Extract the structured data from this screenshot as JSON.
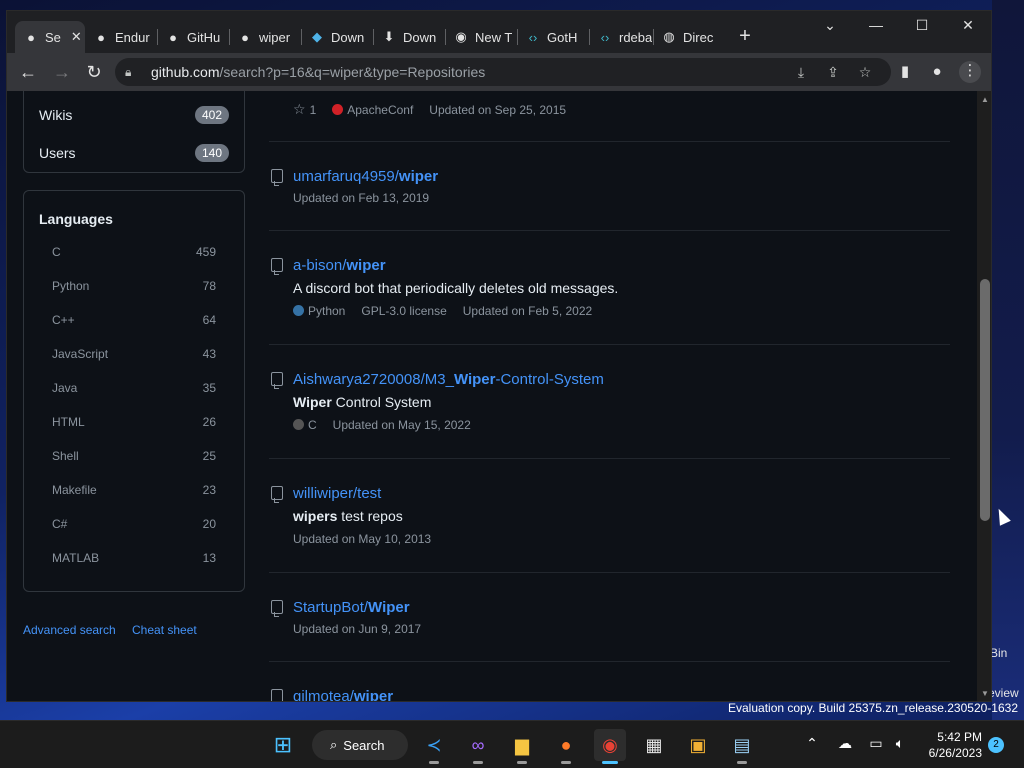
{
  "browser": {
    "tabs": [
      {
        "label": "Se",
        "icon": "github-icon",
        "active": true
      },
      {
        "label": "Endur",
        "icon": "github-icon"
      },
      {
        "label": "GitHu",
        "icon": "github-icon"
      },
      {
        "label": "wiper",
        "icon": "github-icon"
      },
      {
        "label": "Down",
        "icon": "download-chevron-icon"
      },
      {
        "label": "Down",
        "icon": "download-icon"
      },
      {
        "label": "New T",
        "icon": "chrome-icon"
      },
      {
        "label": "GotH",
        "icon": "code-icon"
      },
      {
        "label": "rdeba",
        "icon": "code-icon"
      },
      {
        "label": "Direc",
        "icon": "globe-icon"
      }
    ],
    "url_host": "github.com",
    "url_rest": "/search?p=16&q=wiper&type=Repositories"
  },
  "sidebar": {
    "type_filters": [
      {
        "label": "Wikis",
        "count": "402"
      },
      {
        "label": "Users",
        "count": "140"
      }
    ],
    "languages_title": "Languages",
    "languages": [
      {
        "name": "C",
        "count": "459"
      },
      {
        "name": "Python",
        "count": "78"
      },
      {
        "name": "C++",
        "count": "64"
      },
      {
        "name": "JavaScript",
        "count": "43"
      },
      {
        "name": "Java",
        "count": "35"
      },
      {
        "name": "HTML",
        "count": "26"
      },
      {
        "name": "Shell",
        "count": "25"
      },
      {
        "name": "Makefile",
        "count": "23"
      },
      {
        "name": "C#",
        "count": "20"
      },
      {
        "name": "MATLAB",
        "count": "13"
      }
    ],
    "advanced_search": "Advanced search",
    "cheat_sheet": "Cheat sheet"
  },
  "results": {
    "partial_top": {
      "stars": "1",
      "language": "ApacheConf",
      "language_color": "#d12127",
      "updated": "Updated on Sep 25, 2015"
    },
    "items": [
      {
        "owner": "umarfaruq4959/",
        "match": "wiper",
        "suffix": "",
        "desc_bold": "",
        "desc": "",
        "language": "",
        "license": "",
        "updated": "Updated on Feb 13, 2019"
      },
      {
        "owner": "a-bison/",
        "match": "wiper",
        "suffix": "",
        "desc_bold": "",
        "desc": "A discord bot that periodically deletes old messages.",
        "language": "Python",
        "language_color": "#3572a5",
        "license": "GPL-3.0 license",
        "updated": "Updated on Feb 5, 2022"
      },
      {
        "owner": "Aishwarya2720008/M3_",
        "match": "Wiper",
        "suffix": "-Control-System",
        "desc_bold": "Wiper",
        "desc": " Control System",
        "language": "C",
        "language_color": "#555555",
        "license": "",
        "updated": "Updated on May 15, 2022"
      },
      {
        "owner": "williwiper/test",
        "match": "",
        "suffix": "",
        "desc_bold": "wipers",
        "desc": " test repos",
        "language": "",
        "license": "",
        "updated": "Updated on May 10, 2013"
      },
      {
        "owner": "StartupBot/",
        "match": "Wiper",
        "suffix": "",
        "desc_bold": "",
        "desc": "",
        "language": "",
        "license": "",
        "updated": "Updated on Jun 9, 2017"
      },
      {
        "owner": "gjlmotea/",
        "match": "wiper",
        "suffix": "",
        "desc_bold": "",
        "desc": "",
        "language": "",
        "license": "",
        "updated": ""
      }
    ]
  },
  "desktop": {
    "eval_text": "Evaluation copy. Build 25375.zn_release.230520-1632",
    "bin_text": "Bin",
    "review_text": "eview"
  },
  "taskbar": {
    "search_label": "Search",
    "time": "5:42 PM",
    "date": "6/26/2023",
    "notifications": "2"
  }
}
